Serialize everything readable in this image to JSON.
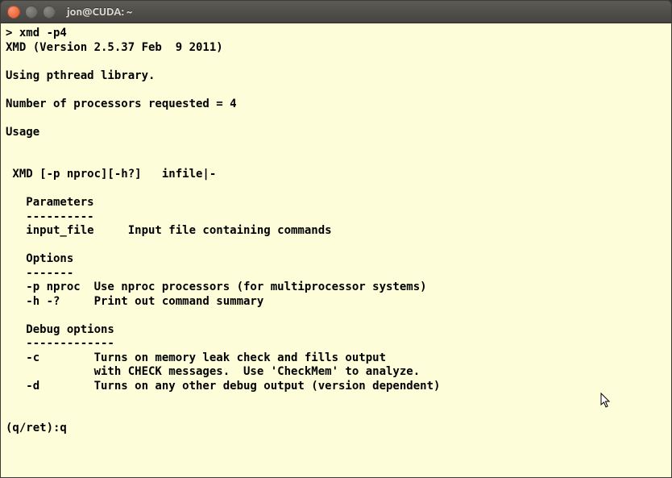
{
  "window": {
    "title": "jon@CUDA: ~"
  },
  "terminal": {
    "prompt": "> ",
    "command": "xmd -p4",
    "lines": {
      "l01": "XMD (Version 2.5.37 Feb  9 2011)",
      "l02": "",
      "l03": "Using pthread library.",
      "l04": "",
      "l05": "Number of processors requested = 4",
      "l06": "",
      "l07": "Usage",
      "l08": "",
      "l09": "",
      "l10": " XMD [-p nproc][-h?]   infile|-",
      "l11": "",
      "l12": "   Parameters",
      "l13": "   ----------",
      "l14": "   input_file     Input file containing commands",
      "l15": "",
      "l16": "   Options",
      "l17": "   -------",
      "l18": "   -p nproc  Use nproc processors (for multiprocessor systems)",
      "l19": "   -h -?     Print out command summary",
      "l20": "",
      "l21": "   Debug options",
      "l22": "   -------------",
      "l23": "   -c        Turns on memory leak check and fills output",
      "l24": "             with CHECK messages.  Use 'CheckMem' to analyze.",
      "l25": "   -d        Turns on any other debug output (version dependent)",
      "l26": "",
      "l27": "",
      "l28": "(q/ret):q"
    }
  }
}
